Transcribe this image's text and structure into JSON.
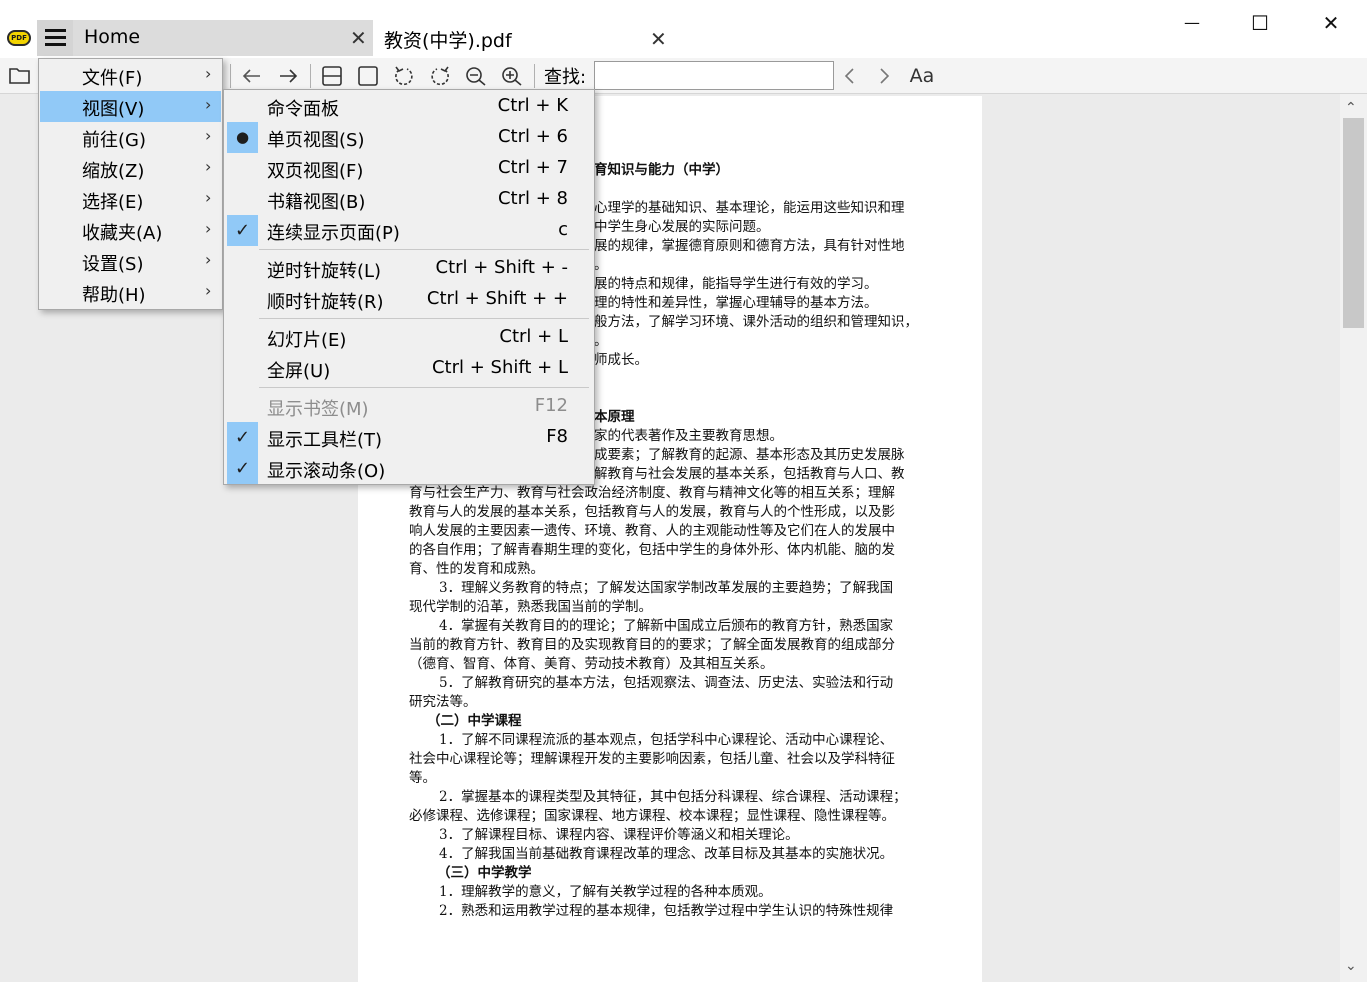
{
  "app": {
    "logo_text": "PDF"
  },
  "tabs": [
    {
      "label": "Home",
      "close": "✕"
    },
    {
      "label": "教资(中学).pdf",
      "close": "✕"
    }
  ],
  "window_controls": {
    "minimize": "—",
    "maximize": "☐",
    "close": "✕"
  },
  "toolbar": {
    "search_label": "查找:",
    "search_value": "",
    "search_placeholder": "",
    "font_button": "Aa"
  },
  "main_menu": {
    "items": [
      {
        "label": "文件(F)",
        "arrow": "›"
      },
      {
        "label": "视图(V)",
        "arrow": "›"
      },
      {
        "label": "前往(G)",
        "arrow": "›"
      },
      {
        "label": "缩放(Z)",
        "arrow": "›"
      },
      {
        "label": "选择(E)",
        "arrow": "›"
      },
      {
        "label": "收藏夹(A)",
        "arrow": "›"
      },
      {
        "label": "设置(S)",
        "arrow": "›"
      },
      {
        "label": "帮助(H)",
        "arrow": "›"
      }
    ],
    "highlighted": "视图(V)"
  },
  "view_menu": {
    "items": [
      {
        "label": "命令面板",
        "shortcut": "Ctrl + K",
        "mark": ""
      },
      {
        "label": "单页视图(S)",
        "shortcut": "Ctrl + 6",
        "mark": "●"
      },
      {
        "label": "双页视图(F)",
        "shortcut": "Ctrl + 7",
        "mark": ""
      },
      {
        "label": "书籍视图(B)",
        "shortcut": "Ctrl + 8",
        "mark": ""
      },
      {
        "label": "连续显示页面(P)",
        "shortcut": "c",
        "mark": "✓"
      },
      {
        "label": "逆时针旋转(L)",
        "shortcut": "Ctrl + Shift + -",
        "mark": ""
      },
      {
        "label": "顺时针旋转(R)",
        "shortcut": "Ctrl + Shift + +",
        "mark": ""
      },
      {
        "label": "幻灯片(E)",
        "shortcut": "Ctrl + L",
        "mark": ""
      },
      {
        "label": "全屏(U)",
        "shortcut": "Ctrl + Shift + L",
        "mark": ""
      },
      {
        "label": "显示书签(M)",
        "shortcut": "F12",
        "mark": "",
        "disabled": true
      },
      {
        "label": "显示工具栏(T)",
        "shortcut": "F8",
        "mark": "✓"
      },
      {
        "label": "显示滚动条(O)",
        "shortcut": "",
        "mark": "✓"
      }
    ]
  },
  "document": {
    "lines": [
      "",
      "",
      "",
      "育知识与能力（中学）",
      "",
      "心理学的基础知识、基本理论，能运用这些知识和理",
      "中学生身心发展的实际问题。",
      "展的规律，掌握德育原则和德育方法，具有针对性地",
      "。",
      "展的特点和规律，能指导学生进行有效的学习。",
      "理的特性和差异性，掌握心理辅导的基本方法。",
      "般方法，了解学习环境、课外活动的组织和管理知识，",
      "。",
      "师成长。",
      "",
      "",
      "本原理",
      "家的代表著作及主要教育思想。",
      "成要素；了解教育的起源、基本形态及其历史发展脉",
      "解教育与社会发展的基本关系，包括教育与人口、教",
      "育与社会生产力、教育与社会政治经济制度、教育与精神文化等的相互关系；理解",
      "教育与人的发展的基本关系，包括教育与人的发展，教育与人的个性形成，以及影",
      "响人发展的主要因素一遗传、环境、教育、人的主观能动性等及它们在人的发展中",
      "的各自作用；了解青春期生理的变化，包括中学生的身体外形、体内机能、脑的发",
      "育、性的发育和成熟。",
      "3．理解义务教育的特点；了解发达国家学制改革发展的主要趋势；了解我国",
      "现代学制的沿革，熟悉我国当前的学制。",
      "4．掌握有关教育目的的理论；了解新中国成立后颁布的教育方针，熟悉国家",
      "当前的教育方针、教育目的及实现教育目的的要求；了解全面发展教育的组成部分",
      "（德育、智育、体育、美育、劳动技术教育）及其相互关系。",
      "5．了解教育研究的基本方法，包括观察法、调查法、历史法、实验法和行动",
      "研究法等。",
      "（二）中学课程",
      "1．了解不同课程流派的基本观点，包括学科中心课程论、活动中心课程论、",
      "社会中心课程论等；理解课程开发的主要影响因素，包括儿童、社会以及学科特征",
      "等。",
      "2．掌握基本的课程类型及其特征，其中包括分科课程、综合课程、活动课程；",
      "必修课程、选修课程；国家课程、地方课程、校本课程；显性课程、隐性课程等。",
      "3．了解课程目标、课程内容、课程评价等涵义和相关理论。",
      "4．了解我国当前基础教育课程改革的理念、改革目标及其基本的实施状况。",
      "（三）中学教学",
      "1．理解教学的意义，了解有关教学过程的各种本质观。",
      "2．熟悉和运用教学过程的基本规律，包括教学过程中学生认识的特殊性规律"
    ]
  }
}
